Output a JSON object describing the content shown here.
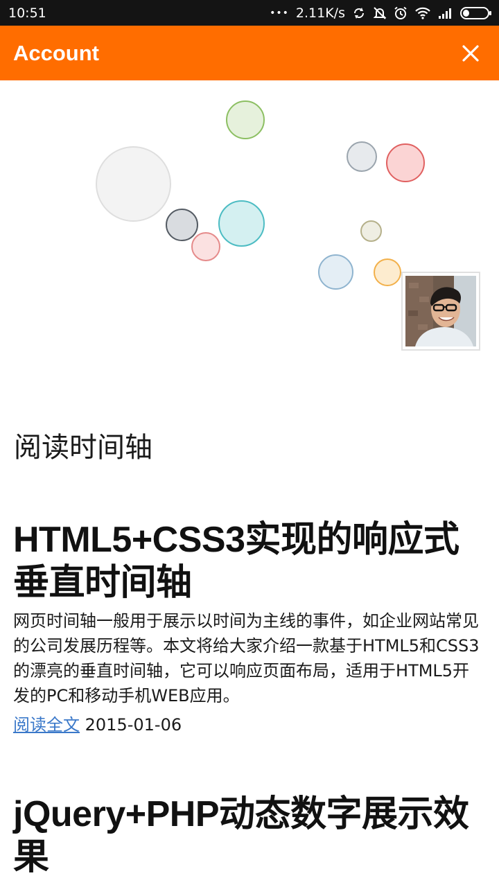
{
  "status_bar": {
    "time": "10:51",
    "dots": "•••",
    "speed": "2.11K/s",
    "icons": [
      "sync-icon",
      "mute-icon",
      "alarm-icon",
      "wifi-icon",
      "signal-icon",
      "battery-icon"
    ]
  },
  "app_bar": {
    "title": "Account",
    "close_icon": "close-icon",
    "background": "#ff6d00"
  },
  "hero": {
    "avatar": "profile-avatar"
  },
  "section": {
    "title": "阅读时间轴"
  },
  "articles": [
    {
      "title": "HTML5+CSS3实现的响应式垂直时间轴",
      "summary": "网页时间轴一般用于展示以时间为主线的事件，如企业网站常见的公司发展历程等。本文将给大家介绍一款基于HTML5和CSS3的漂亮的垂直时间轴，它可以响应页面布局，适用于HTML5开发的PC和移动手机WEB应用。",
      "read_more": "阅读全文",
      "date": "2015-01-06"
    },
    {
      "title": "jQuery+PHP动态数字展示效果"
    }
  ]
}
